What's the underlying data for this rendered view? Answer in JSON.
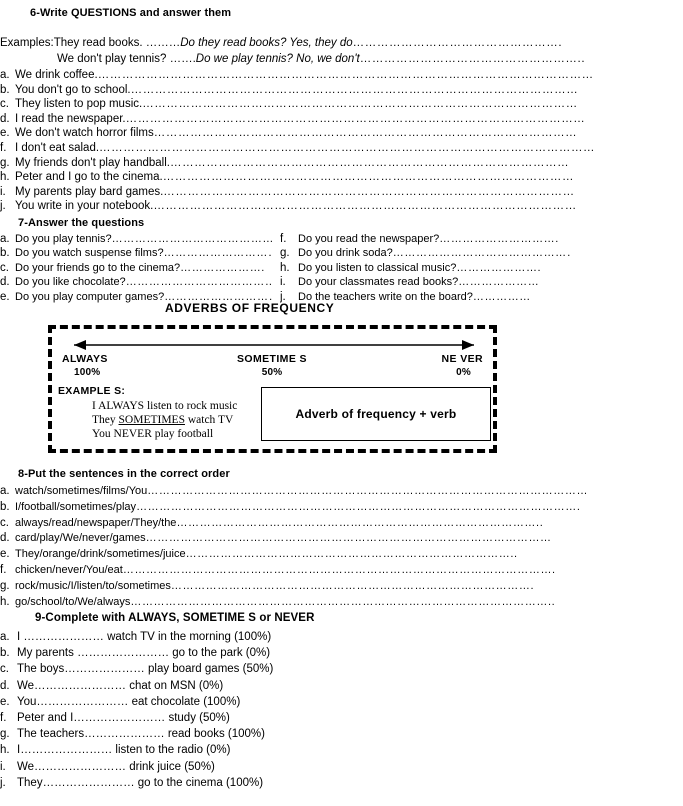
{
  "section6": {
    "heading": "6-Write QUESTIONS and answer them",
    "examples": [
      {
        "label": "Examples:",
        "lead": " They read books. ………",
        "answer": "Do they read books? Yes, they do",
        "tail": "……………………………………………."
      },
      {
        "label": "",
        "lead": "We don't play tennis? …….",
        "answer": "Do we play tennis? No, we don't",
        "tail": "……………………………………………….."
      }
    ],
    "items": [
      {
        "letter": "a.",
        "text": "We drink coffee.",
        "dots": "……………………………………………………………………………………………………………"
      },
      {
        "letter": "b.",
        "text": "You don't go to school.",
        "dots": "…………………………………………………………………………………………………"
      },
      {
        "letter": "c.",
        "text": "They listen to pop music.",
        "dots": "………………………………………………………………………………………………"
      },
      {
        "letter": "d.",
        "text": "I read the newspaper.",
        "dots": "……………………………………………………………………………………………………"
      },
      {
        "letter": "e.",
        "text": "We don't watch horror films",
        "dots": "……………………………………………………………………………………………"
      },
      {
        "letter": "f.",
        "text": "I don't eat salad.",
        "dots": "……………………………………………………………………………………………………………"
      },
      {
        "letter": "g.",
        "text": "My friends don't play handball.",
        "dots": "………………………………………………………………………………………"
      },
      {
        "letter": "h.",
        "text": "Peter and I go to the cinema.",
        "dots": "…………………………………………………………………………………………"
      },
      {
        "letter": "i.",
        "text": "My parents play bard games.",
        "dots": "…………………………………………………………………………………………"
      },
      {
        "letter": "j.",
        "text": "You write in your notebook.",
        "dots": "……………………………………………………………………………………………"
      }
    ]
  },
  "section7": {
    "heading": "7-Answer the questions",
    "left_items": [
      {
        "letter": "a.",
        "text": "Do you play tennis?",
        "dots": "…………………………………….."
      },
      {
        "letter": "b.",
        "text": "Do you watch suspense films? ",
        "dots": "…………………………"
      },
      {
        "letter": "c.",
        "text": "Do your friends go to the cinema? ",
        "dots": "…………………."
      },
      {
        "letter": "d.",
        "text": "Do you like chocolate? ",
        "dots": "………………………………………"
      },
      {
        "letter": "e.",
        "text": "Do you play computer games? ",
        "dots": "…………………………"
      }
    ],
    "right_items": [
      {
        "letter": "f.",
        "text": "Do you read the newspaper? ",
        "dots": "…………………………."
      },
      {
        "letter": "g.",
        "text": "Do you drink soda? ",
        "dots": "…………………………………………."
      },
      {
        "letter": "h.",
        "text": "Do you listen to classical music? ",
        "dots": "…………………."
      },
      {
        "letter": "i.",
        "text": "Do your classmates read books? ",
        "dots": "…………………"
      },
      {
        "letter": "j.",
        "text": "Do the teachers write on the board? ",
        "dots": "……………"
      }
    ]
  },
  "adverbs_panel": {
    "title": "ADVERBS OF FREQUENCY",
    "scale": [
      {
        "label": "ALWAYS",
        "percent": "100%"
      },
      {
        "label": "SOMETIME S",
        "percent": "50%"
      },
      {
        "label": "NE VER",
        "percent": "0%"
      }
    ],
    "examples_heading": "EXAMPLE S:",
    "examples": [
      {
        "pre": "I ALWAYS",
        "post": " listen to rock music",
        "underlined": ""
      },
      {
        "pre": "They ",
        "underlined": "SOMETIMES",
        "post": " watch TV"
      },
      {
        "pre": "You NEVER play football",
        "post": "",
        "underlined": ""
      }
    ],
    "rule": "Adverb of frequency + verb"
  },
  "section8": {
    "heading": "8-Put the sentences in the correct order",
    "items": [
      {
        "letter": "a.",
        "text": "watch/sometimes/films/You",
        "dots": "……………………………………………………………………………………………………"
      },
      {
        "letter": "b.",
        "text": "I/football/sometimes/play",
        "dots": "……………………………………………………………………………………………………."
      },
      {
        "letter": "c.",
        "text": "always/read/newspaper/They/the",
        "dots": "………………………………………………………………………………….."
      },
      {
        "letter": "d.",
        "text": "card/play/We/never/games",
        "dots": "……………………………………………………………………………………………"
      },
      {
        "letter": "e.",
        "text": "They/orange/drink/sometimes/juice",
        "dots": "………………………………………………………………………….."
      },
      {
        "letter": "f.",
        "text": "chicken/never/You/eat",
        "dots": "…………………………………………………………………………………………………."
      },
      {
        "letter": "g.",
        "text": "rock/music/I/listen/to/sometimes",
        "dots": "…………………………………………………………………………………."
      },
      {
        "letter": "h.",
        "text": "go/school/to/We/always",
        "dots": "……………………………………………………………………………………………….."
      }
    ]
  },
  "section9": {
    "heading": "9-Complete with ALWAYS, SOMETIME S or NEVER",
    "items": [
      {
        "letter": "a.",
        "text": "I ………………… watch TV in the morning (100%)"
      },
      {
        "letter": "b.",
        "text": "My parents …………………… go to the park (0%)"
      },
      {
        "letter": "c.",
        "text": "The boys………………… play board games (50%)"
      },
      {
        "letter": "d.",
        "text": "We…………………… chat on MSN (0%)"
      },
      {
        "letter": "e.",
        "text": "You…………………… eat chocolate (100%)"
      },
      {
        "letter": "f.",
        "text": "Peter and I…………………… study (50%)"
      },
      {
        "letter": "g.",
        "text": "The teachers………………… read books (100%)"
      },
      {
        "letter": "h.",
        "text": "I…………………… listen to the radio (0%)"
      },
      {
        "letter": "i.",
        "text": "We…………………… drink juice (50%)"
      },
      {
        "letter": "j.",
        "text": "They…………………… go to the cinema (100%)"
      }
    ]
  }
}
